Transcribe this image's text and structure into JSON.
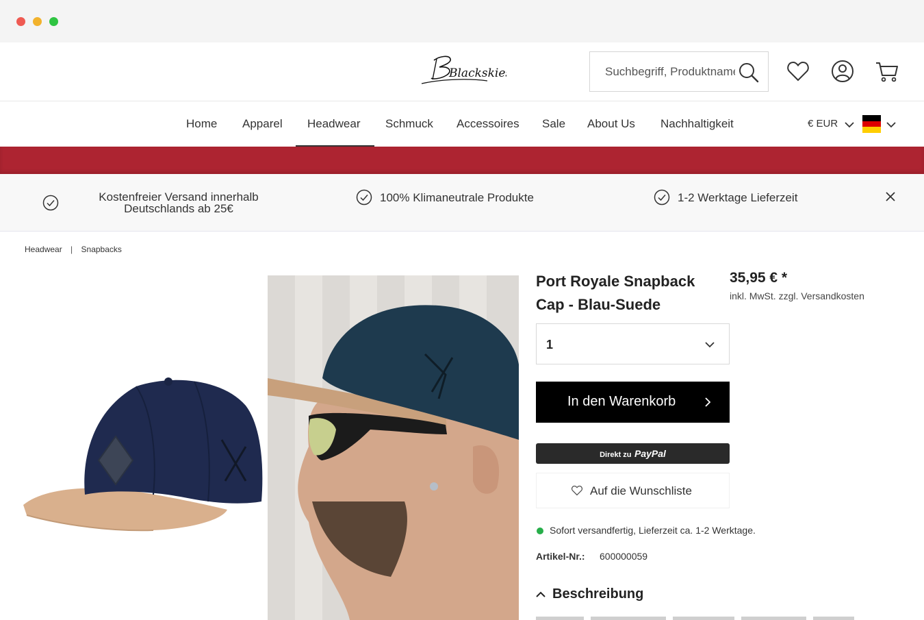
{
  "header": {
    "logo_text": "Blackskies",
    "search_placeholder": "Suchbegriff, Produktname"
  },
  "nav": {
    "items": [
      {
        "label": "Home"
      },
      {
        "label": "Apparel"
      },
      {
        "label": "Headwear"
      },
      {
        "label": "Schmuck"
      },
      {
        "label": "Accessoires"
      },
      {
        "label": "Sale"
      },
      {
        "label": "About Us"
      },
      {
        "label": "Nachhaltigkeit"
      }
    ],
    "active": "Headwear",
    "currency": "€ EUR",
    "language_flag": "de-flag"
  },
  "colors": {
    "banner": "#ad2431",
    "button": "#000000",
    "stock": "#27ae4a"
  },
  "usp": {
    "items": [
      {
        "text": "Kostenfreier Versand innerhalb Deutschlands ab 25€"
      },
      {
        "text": "100% Klimaneutrale Produkte"
      },
      {
        "text": "1-2 Werktage Lieferzeit"
      }
    ]
  },
  "breadcrumb": {
    "items": [
      "Headwear",
      "Snapbacks"
    ],
    "separator": "|"
  },
  "product": {
    "title": "Port Royale Snapback Cap - Blau-Suede",
    "price": "35,95 € *",
    "tax_note": "inkl. MwSt. zzgl. Versandkosten",
    "quantity": "1",
    "add_to_cart_label": "In den Warenkorb",
    "paypal_prefix": "Direkt zu",
    "paypal_brand": "PayPal",
    "wishlist_label": "Auf die Wunschliste",
    "stock_text": "Sofort versandfertig, Lieferzeit ca. 1-2 Werktage.",
    "article_label": "Artikel-Nr.:",
    "article_number": "600000059",
    "description_heading": "Beschreibung"
  }
}
